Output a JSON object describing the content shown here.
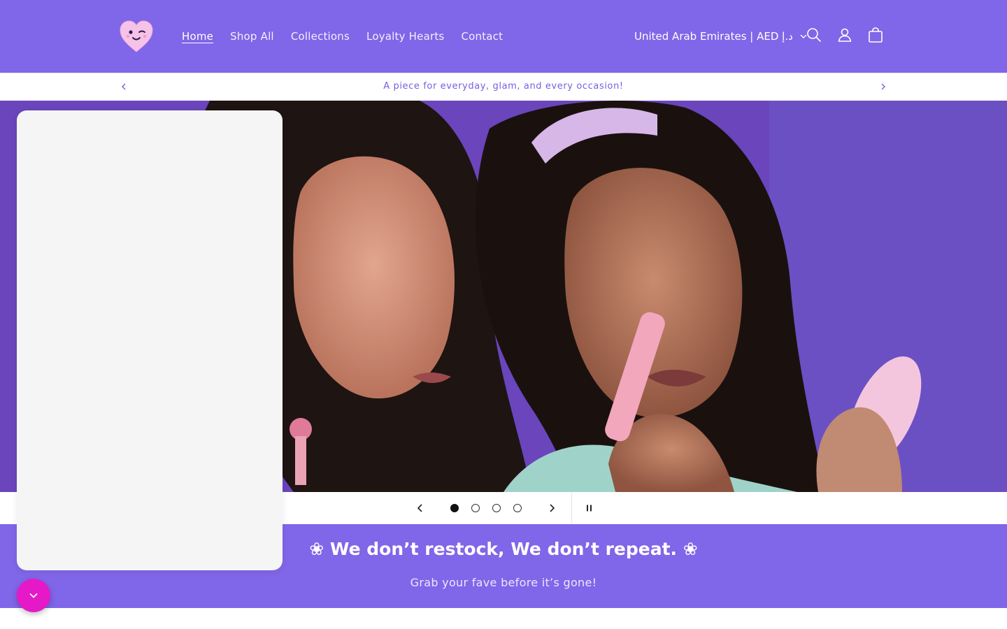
{
  "header": {
    "nav": [
      {
        "label": "Home",
        "active": true
      },
      {
        "label": "Shop All"
      },
      {
        "label": "Collections"
      },
      {
        "label": "Loyalty Hearts"
      },
      {
        "label": "Contact"
      }
    ],
    "country_selector": "United Arab Emirates | AED د.إ",
    "icons": [
      "search-icon",
      "account-icon",
      "cart-icon"
    ],
    "colors": {
      "background": "#8066e8",
      "text": "#ffffff"
    }
  },
  "announcement": {
    "text": "A piece for everyday, glam, and every occasion!",
    "color": "#7a5ee0"
  },
  "slideshow": {
    "slide_count": 4,
    "active_slide": 1,
    "controls": [
      "previous-slide",
      "next-slide",
      "pause"
    ]
  },
  "promo": {
    "title": "❀ We don’t restock, We don’t repeat. ❀",
    "subtitle": "Grab your fave before it’s gone!",
    "background": "#8066e8"
  },
  "widget": {
    "fab_color": "#e619c8",
    "fab_icon": "chevron-down-icon"
  }
}
